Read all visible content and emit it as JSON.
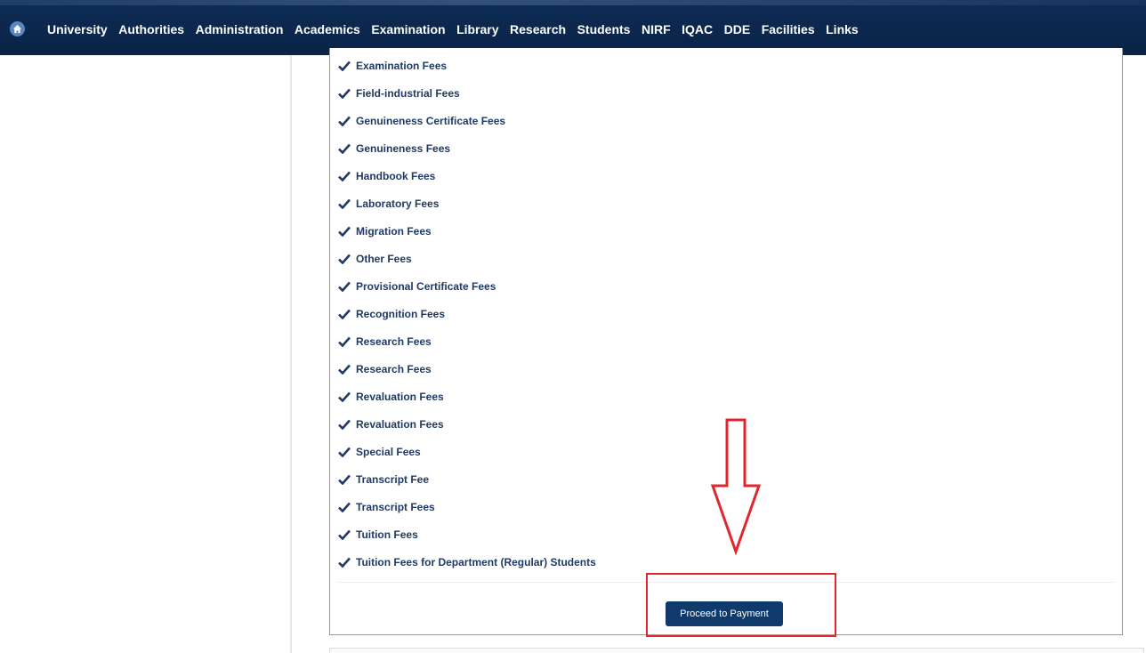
{
  "nav": {
    "home_icon": "home-icon",
    "items": [
      "University",
      "Authorities",
      "Administration",
      "Academics",
      "Examination",
      "Library",
      "Research",
      "Students",
      "NIRF",
      "IQAC",
      "DDE",
      "Facilities",
      "Links"
    ]
  },
  "fees": [
    "Examination Fees",
    "Field-industrial Fees",
    "Genuineness Certificate Fees",
    "Genuineness Fees",
    "Handbook Fees",
    "Laboratory Fees",
    "Migration Fees",
    "Other Fees",
    "Provisional Certificate Fees",
    "Recognition Fees",
    "Research Fees",
    "Research Fees",
    "Revaluation Fees",
    "Revaluation Fees",
    "Special Fees",
    "Transcript Fee",
    "Transcript Fees",
    "Tuition Fees",
    "Tuition Fees for Department (Regular) Students"
  ],
  "fee_icon": "checkmark-icon",
  "payment": {
    "button_label": "Proceed to Payment"
  },
  "annotation": {
    "arrow_icon": "down-arrow-icon",
    "color": "#e0262e"
  },
  "colors": {
    "nav_bg": "#0a2347",
    "button_bg": "#0f3a6b",
    "text": "#1f3a66"
  }
}
